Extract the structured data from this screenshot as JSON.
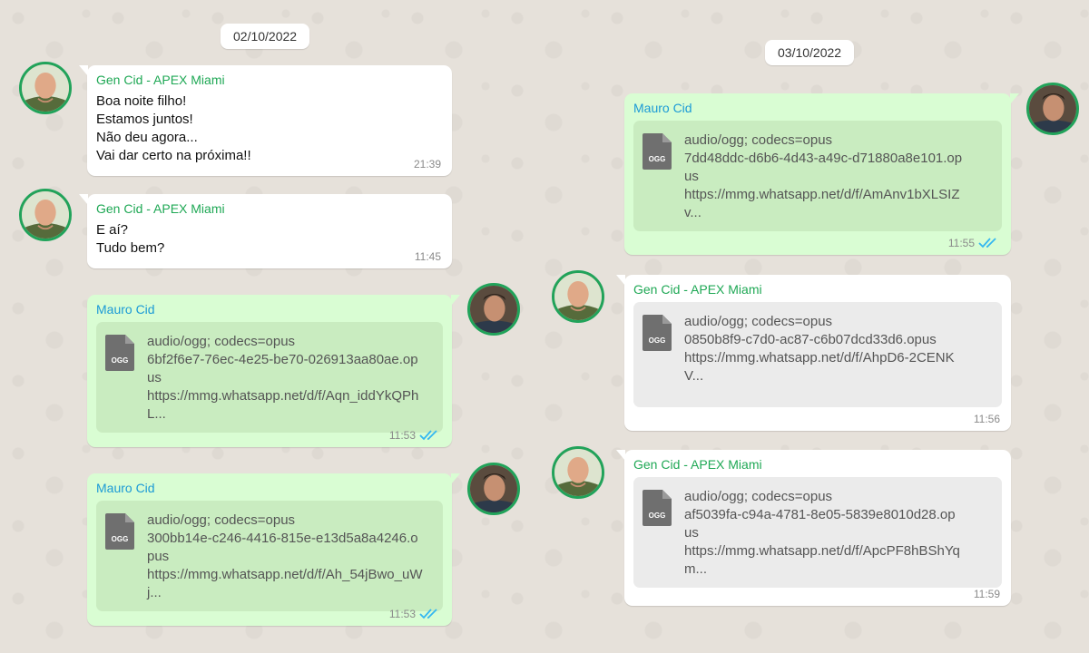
{
  "dates": {
    "left": "02/10/2022",
    "right": "03/10/2022"
  },
  "colors": {
    "outgoing_bubble": "#d9fdd3",
    "incoming_bubble": "#ffffff",
    "general_name": "#1fa855",
    "mauro_name": "#1b9ad6",
    "read_ticks": "#34b7f1"
  },
  "icons": {
    "file": "ogg-file-icon",
    "read": "double-check-icon"
  },
  "messages": [
    {
      "sender": "Gen Cid - APEX Miami",
      "lines": [
        "Boa noite filho!",
        "Estamos juntos!",
        "Não deu agora...",
        "Vai dar certo na próxima!!"
      ],
      "time": "21:39"
    },
    {
      "sender": "Gen Cid - APEX Miami",
      "lines": [
        "E aí?",
        "Tudo bem?"
      ],
      "time": "11:45"
    },
    {
      "sender": "Mauro Cid",
      "file_label": "OGG",
      "file_lines": [
        "audio/ogg; codecs=opus",
        "6bf2f6e7-76ec-4e25-be70-026913aa80ae.op",
        "us",
        "https://mmg.whatsapp.net/d/f/Aqn_iddYkQPh",
        "L..."
      ],
      "time": "11:53"
    },
    {
      "sender": "Mauro Cid",
      "file_label": "OGG",
      "file_lines": [
        "audio/ogg; codecs=opus",
        "300bb14e-c246-4416-815e-e13d5a8a4246.o",
        "pus",
        "https://mmg.whatsapp.net/d/f/Ah_54jBwo_uW",
        "j..."
      ],
      "time": "11:53"
    },
    {
      "sender": "Mauro Cid",
      "file_label": "OGG",
      "file_lines": [
        "audio/ogg; codecs=opus",
        "7dd48ddc-d6b6-4d43-a49c-d71880a8e101.op",
        "us",
        "https://mmg.whatsapp.net/d/f/AmAnv1bXLSIZ",
        "v..."
      ],
      "time": "11:55"
    },
    {
      "sender": "Gen Cid - APEX Miami",
      "file_label": "OGG",
      "file_lines": [
        "audio/ogg; codecs=opus",
        "0850b8f9-c7d0-ac87-c6b07dcd33d6.opus",
        "https://mmg.whatsapp.net/d/f/AhpD6-2CENK",
        "V..."
      ],
      "time": "11:56"
    },
    {
      "sender": "Gen Cid - APEX Miami",
      "file_label": "OGG",
      "file_lines": [
        "audio/ogg; codecs=opus",
        "af5039fa-c94a-4781-8e05-5839e8010d28.op",
        "us",
        "https://mmg.whatsapp.net/d/f/ApcPF8hBShYq",
        "m..."
      ],
      "time": "11:59"
    }
  ]
}
